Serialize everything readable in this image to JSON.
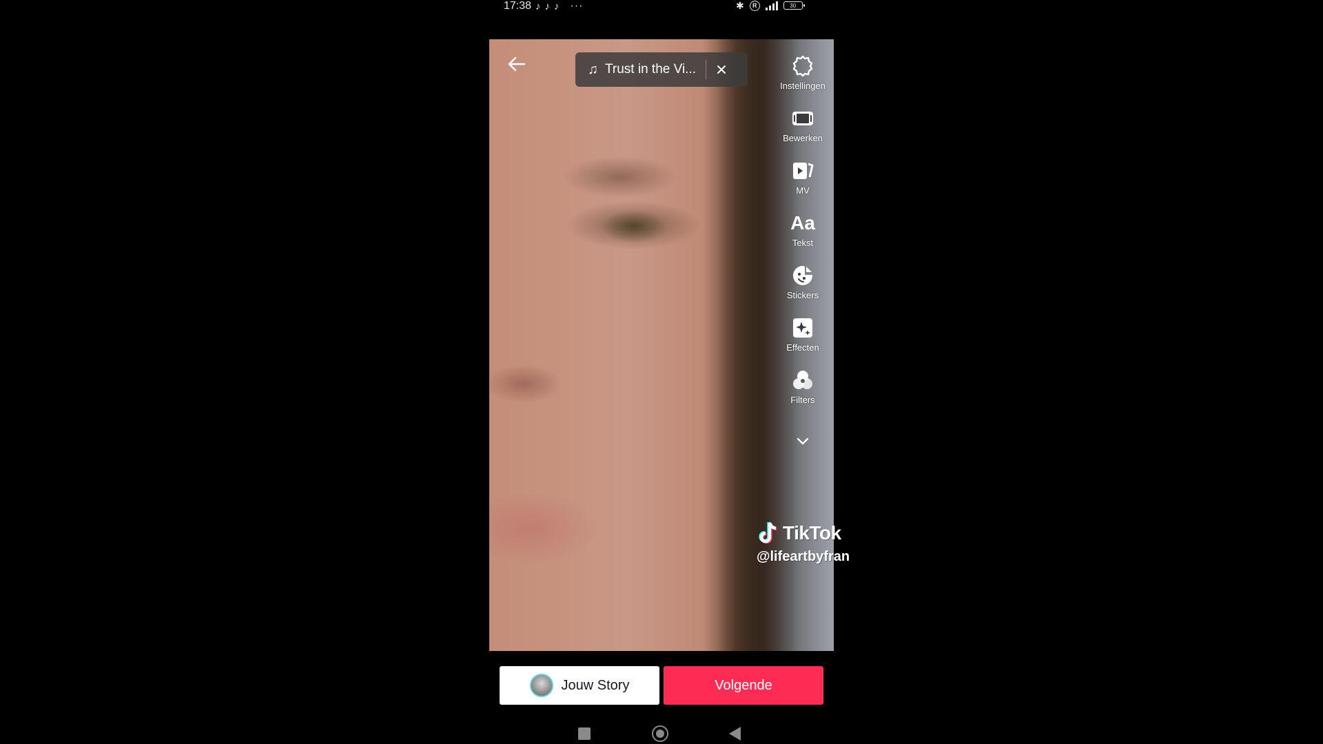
{
  "status_bar": {
    "time": "17:38",
    "notification_icons": [
      "tiktok-note-icon",
      "tiktok-note-icon",
      "tiktok-note-icon"
    ],
    "more": "···",
    "battery": "30"
  },
  "editor": {
    "music": {
      "title": "Trust in the Vi..."
    },
    "toolbar": [
      {
        "label": "Instellingen",
        "icon": "settings-icon"
      },
      {
        "label": "Bewerken",
        "icon": "edit-clip-icon"
      },
      {
        "label": "MV",
        "icon": "mv-icon"
      },
      {
        "label": "Tekst",
        "icon": "text-icon",
        "glyph": "Aa"
      },
      {
        "label": "Stickers",
        "icon": "sticker-icon"
      },
      {
        "label": "Effecten",
        "icon": "effects-icon"
      },
      {
        "label": "Filters",
        "icon": "filters-icon"
      }
    ],
    "watermark": {
      "brand": "TikTok",
      "handle": "@lifeartbyfran"
    }
  },
  "actions": {
    "story_label": "Jouw Story",
    "next_label": "Volgende"
  },
  "colors": {
    "accent": "#fe2c55",
    "story_ring": "#61d2e6",
    "background": "#000000"
  }
}
